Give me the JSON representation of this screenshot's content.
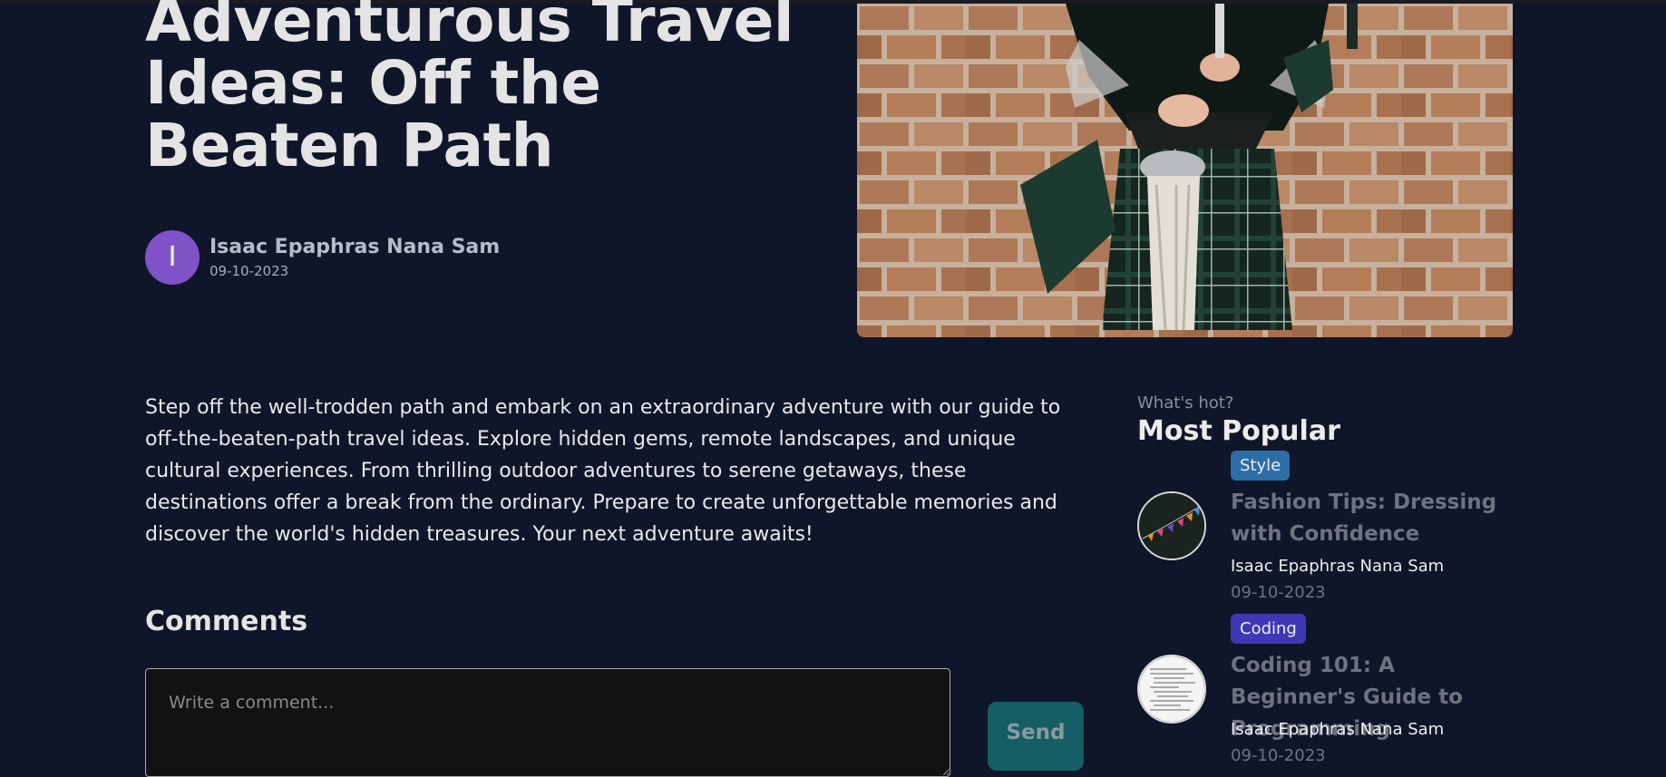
{
  "colors": {
    "page_background": "#0f1629",
    "avatar": "#8052c8",
    "style_tag": "#2d6ea6",
    "coding_tag": "#3f38b5",
    "send_button": "#155e63"
  },
  "post": {
    "title": "Adventurous Travel Ideas: Off the Beaten Path",
    "author_initial": "I",
    "author_name": "Isaac Epaphras Nana Sam",
    "date": "09-10-2023",
    "body": "Step off the well-trodden path and embark on an extraordinary adventure with our guide to off-the-beaten-path travel ideas. Explore hidden gems, remote landscapes, and unique cultural experiences. From thrilling outdoor adventures to serene getaways, these destinations offer a break from the ordinary. Prepare to create unforgettable memories and discover the world's hidden treasures. Your next adventure awaits!"
  },
  "comments": {
    "heading": "Comments",
    "placeholder": "Write a comment...",
    "send_label": "Send"
  },
  "sidebar": {
    "subtitle": "What's hot?",
    "title": "Most Popular",
    "items": [
      {
        "category": "Style",
        "title": "Fashion Tips: Dressing with Confidence",
        "author": "Isaac Epaphras Nana Sam",
        "date": "09-10-2023"
      },
      {
        "category": "Coding",
        "title": "Coding 101: A Beginner's Guide to Programming",
        "author": "Isaac Epaphras Nana Sam",
        "date": "09-10-2023"
      }
    ]
  }
}
